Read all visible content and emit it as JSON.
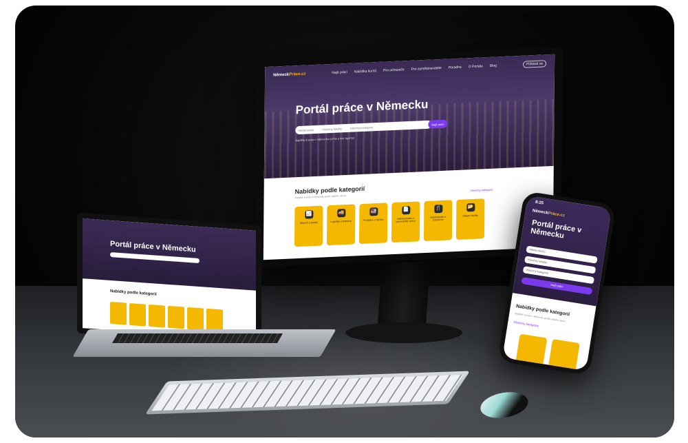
{
  "monitor": {
    "logo_main": "Německ",
    "logo_accent": "Práce.cz",
    "nav_items": [
      "Najít práci",
      "Nabídka kurzů",
      "Pro uchazeče",
      "Pro zaměstnavatele",
      "Poradna",
      "O Portálu",
      "Blog"
    ],
    "nav_button": "Přihlásit se",
    "hero_title": "Portál práce v Německu",
    "search_placeholder": "Hledat pozici",
    "search_location": "Všechny lokality",
    "search_category": "Všechny kategorie",
    "search_button": "Najít práci",
    "hero_sub": "Najděte si práci v Německu rychle a bez agentur",
    "categories_title": "Nabídky podle kategorií",
    "categories_sub": "Najděte si práci v Německu podle vašeho oboru",
    "categories_all": "Všechny kategorie",
    "cards": [
      {
        "icon": "chart-icon",
        "glyph": "📈",
        "label": "Obchod a prodej"
      },
      {
        "icon": "truck-icon",
        "glyph": "🚚",
        "label": "Logistika a doprava"
      },
      {
        "icon": "factory-icon",
        "glyph": "🏭",
        "label": "Produkce a výroba"
      },
      {
        "icon": "document-icon",
        "glyph": "📄",
        "label": "Administrativa a kancelářské práce"
      },
      {
        "icon": "cutlery-icon",
        "glyph": "🍴",
        "label": "Gastronomie a hotelnictví"
      },
      {
        "icon": "folder-icon",
        "glyph": "📂",
        "label": "Ostatní služby"
      }
    ]
  },
  "laptop": {
    "hero_title": "Portál práce v Německu",
    "categories_title": "Nabídky podle kategorií"
  },
  "phone": {
    "time": "8:25",
    "logo_main": "Německ",
    "logo_accent": "Práce.cz",
    "hero_title": "Portál práce v Německu",
    "field_search": "Hledat pozici...",
    "field_location": "Všechny lokality",
    "field_category": "Všechny kategorie",
    "button": "Najít práci",
    "categories_title": "Nabídky podle kategorií",
    "categories_sub": "Najděte si práci v Německu podle vašeho oboru",
    "categories_all": "Všechny kategorie"
  },
  "colors": {
    "accent_yellow": "#f5b800",
    "accent_purple": "#7c3aed",
    "hero_bg": "#3a2a55"
  }
}
